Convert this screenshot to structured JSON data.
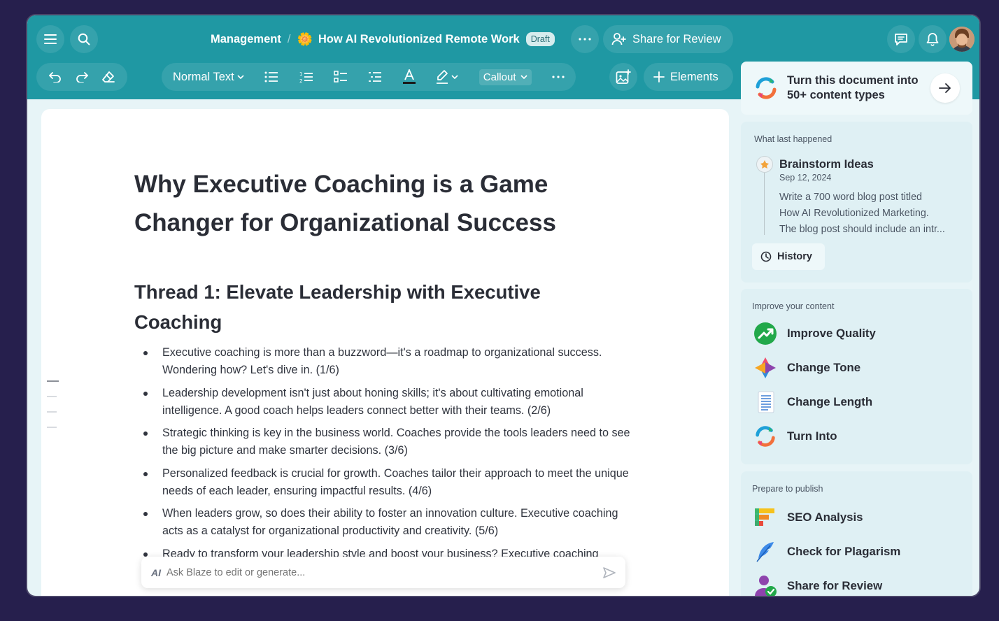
{
  "header": {
    "breadcrumb_root": "Management",
    "breadcrumb_sep": "/",
    "doc_icon": "🌼",
    "doc_title": "How AI Revolutionized Remote Work",
    "status_badge": "Draft",
    "share_label": "Share for Review"
  },
  "toolbar": {
    "text_style": "Normal Text",
    "callout_label": "Callout",
    "elements_label": "Elements"
  },
  "promo": {
    "text_line1": "Turn this document into",
    "text_line2": "50+ content types"
  },
  "document": {
    "title": "Why Executive Coaching is a Game Changer for Organizational Success",
    "thread_title": "Thread 1: Elevate Leadership with Executive Coaching",
    "bullets": [
      "Executive coaching is more than a buzzword—it's a roadmap to organizational success. Wondering how? Let's dive in. (1/6)",
      "Leadership development isn't just about honing skills; it's about cultivating emotional intelligence. A good coach helps leaders connect better with their teams. (2/6)",
      "Strategic thinking is key in the business world. Coaches provide the tools leaders need to see the big picture and make smarter decisions. (3/6)",
      "Personalized feedback is crucial for growth. Coaches tailor their approach to meet the unique needs of each leader, ensuring impactful results. (4/6)",
      "When leaders grow, so does their ability to foster an innovation culture. Executive coaching acts as a catalyst for organizational productivity and creativity. (5/6)",
      "Ready to transform your leadership style and boost your business? Executive coaching"
    ]
  },
  "ask_bar": {
    "badge": "AI",
    "placeholder": "Ask Blaze to edit or generate..."
  },
  "history_card": {
    "label": "What last happened",
    "title": "Brainstorm Ideas",
    "date": "Sep 12, 2024",
    "body_line1": "Write a 700 word blog post titled",
    "body_line2": "How AI Revolutionized Marketing.",
    "body_line3": "The blog post should include an intr...",
    "history_btn": "History"
  },
  "improve_card": {
    "label": "Improve your content",
    "items": [
      {
        "label": "Improve Quality",
        "icon": "trend-up-icon"
      },
      {
        "label": "Change Tone",
        "icon": "palette-icon"
      },
      {
        "label": "Change Length",
        "icon": "document-lines-icon"
      },
      {
        "label": "Turn Into",
        "icon": "convert-icon"
      }
    ]
  },
  "publish_card": {
    "label": "Prepare to publish",
    "items": [
      {
        "label": "SEO Analysis",
        "icon": "seo-bars-icon"
      },
      {
        "label": "Check for Plagarism",
        "icon": "feather-icon"
      },
      {
        "label": "Share for Review",
        "icon": "user-check-icon"
      }
    ]
  },
  "colors": {
    "teal_header": "#1f98a3",
    "background": "#261f4d",
    "panel": "#dff0f4"
  }
}
